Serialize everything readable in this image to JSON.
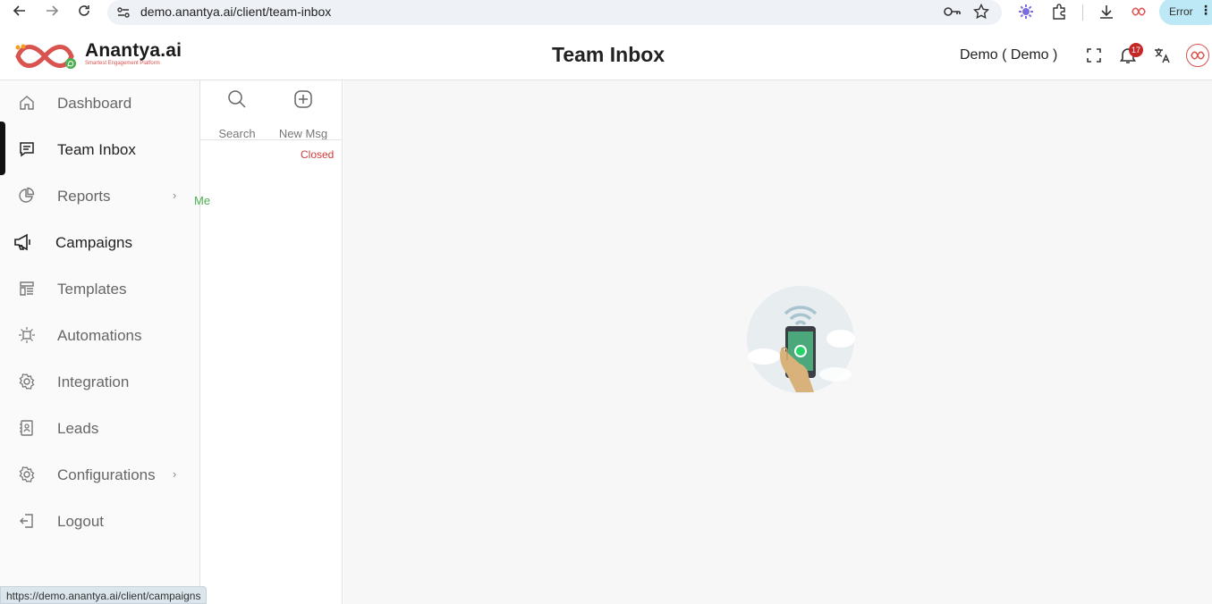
{
  "browser": {
    "url": "demo.anantya.ai/client/team-inbox",
    "profile_status": "Error"
  },
  "header": {
    "brand_name": "Anantya.ai",
    "brand_tagline": "Smartest Engagement Platform",
    "page_title": "Team Inbox",
    "user_label": "Demo ( Demo )",
    "notification_count": "17",
    "colors": {
      "brand_red": "#d9534f",
      "badge_red": "#c62828"
    }
  },
  "sidebar": {
    "items": [
      {
        "label": "Dashboard",
        "icon": "home-icon",
        "has_submenu": false
      },
      {
        "label": "Team Inbox",
        "icon": "chat-icon",
        "has_submenu": false,
        "active": true
      },
      {
        "label": "Reports",
        "icon": "pie-chart-icon",
        "has_submenu": true
      },
      {
        "label": "Campaigns",
        "icon": "megaphone-icon",
        "has_submenu": false
      },
      {
        "label": "Templates",
        "icon": "template-icon",
        "has_submenu": false
      },
      {
        "label": "Automations",
        "icon": "automation-icon",
        "has_submenu": false
      },
      {
        "label": "Integration",
        "icon": "gear-icon",
        "has_submenu": false
      },
      {
        "label": "Leads",
        "icon": "contact-card-icon",
        "has_submenu": false
      },
      {
        "label": "Configurations",
        "icon": "settings-icon",
        "has_submenu": true
      },
      {
        "label": "Logout",
        "icon": "logout-icon",
        "has_submenu": false
      }
    ]
  },
  "list_panel": {
    "search_label": "Search",
    "new_msg_label": "New Msg",
    "status_label": "Closed",
    "assigned_label": "Me"
  },
  "status_bar": {
    "hover_url": "https://demo.anantya.ai/client/campaigns"
  }
}
